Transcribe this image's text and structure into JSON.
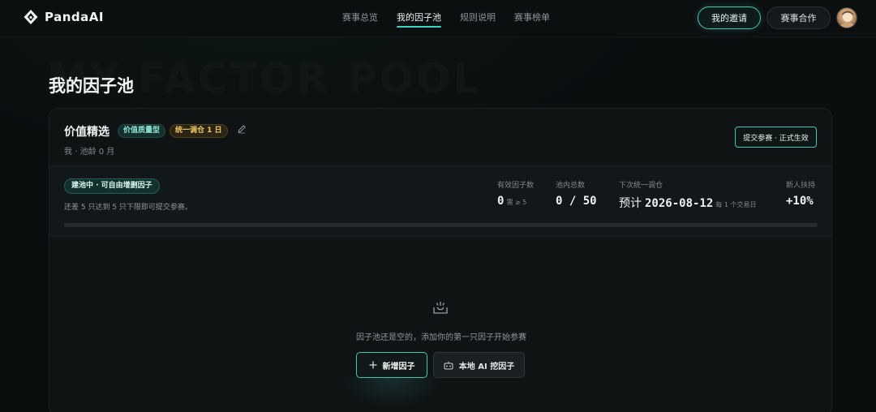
{
  "brand": {
    "name": "PandaAI",
    "logo_icon": "panda-icon"
  },
  "nav": {
    "links": [
      {
        "label": "赛事总览",
        "active": false
      },
      {
        "label": "我的因子池",
        "active": true
      },
      {
        "label": "规则说明",
        "active": false
      },
      {
        "label": "赛事榜单",
        "active": false
      }
    ],
    "invite_label": "我的邀请",
    "coop_label": "赛事合作",
    "avatar_icon": "avatar"
  },
  "header": {
    "bg_word": "MY FACTOR POOL",
    "title": "我的因子池"
  },
  "pool": {
    "name": "价值精选",
    "type_tag": "价值质量型",
    "rebalance_tag": "统一调仓 1 日",
    "meta": "我 · 池龄 0 月",
    "submit_label": "提交参赛 · 正式生效"
  },
  "status": {
    "badge": "建池中 · 可自由增删因子",
    "hint": "还差 5 只达到 5 只下限即可提交参赛。",
    "progress": 0,
    "stats": [
      {
        "label": "有效因子数",
        "value": "0",
        "sub": "需 ≥ 5"
      },
      {
        "label": "池内总数",
        "value": "0 / 50"
      },
      {
        "label": "下次统一调仓",
        "pre": "预计",
        "value": "2026-08-12",
        "sub": "每 1 个交易日"
      },
      {
        "label": "新人扶持",
        "value": "+10%"
      }
    ]
  },
  "empty": {
    "icon": "inbox-icon",
    "text": "因子池还是空的，添加你的第一只因子开始参赛",
    "add_label": "新增因子",
    "local_label": "本地 AI 挖因子"
  },
  "colors": {
    "accent": "#3ec7b5",
    "warn": "#ecc76a",
    "bg": "#0b0e0f"
  }
}
